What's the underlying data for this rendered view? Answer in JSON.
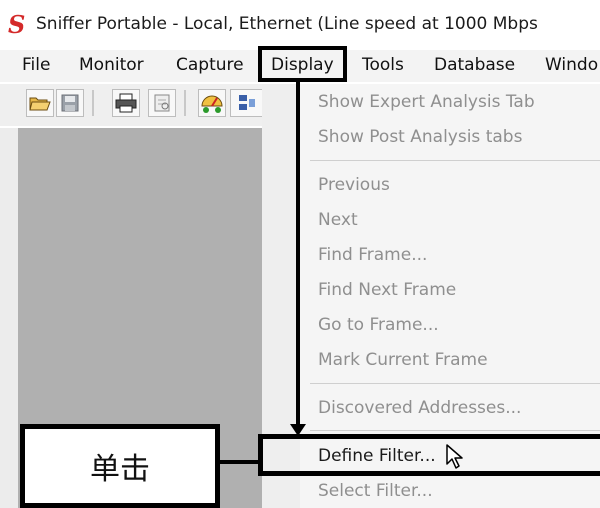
{
  "window": {
    "logo": "S",
    "title": "Sniffer Portable - Local, Ethernet (Line speed at 1000 Mbps"
  },
  "menubar": {
    "items": [
      {
        "label": "File"
      },
      {
        "label": "Monitor"
      },
      {
        "label": "Capture"
      },
      {
        "label": "Display"
      },
      {
        "label": "Tools"
      },
      {
        "label": "Database"
      },
      {
        "label": "Windo"
      }
    ],
    "active": "Display"
  },
  "toolbar": {
    "icons": [
      "open-folder-icon",
      "save-icon",
      "print-icon",
      "print-preview-icon",
      "dashboard-icon",
      "host-table-icon"
    ]
  },
  "display_menu": {
    "items": [
      {
        "label": "Show Expert Analysis Tab",
        "enabled": false
      },
      {
        "label": "Show Post Analysis tabs",
        "enabled": false
      },
      {
        "label": "Previous",
        "enabled": false
      },
      {
        "label": "Next",
        "enabled": false
      },
      {
        "label": "Find Frame...",
        "enabled": false
      },
      {
        "label": "Find Next Frame",
        "enabled": false
      },
      {
        "label": "Go to Frame...",
        "enabled": false
      },
      {
        "label": "Mark Current Frame",
        "enabled": false
      },
      {
        "label": "Discovered Addresses...",
        "enabled": false
      },
      {
        "label": "Define Filter...",
        "enabled": true
      },
      {
        "label": "Select Filter...",
        "enabled": false
      }
    ]
  },
  "annotation": {
    "callout": "单击",
    "color": "#000000"
  },
  "colors": {
    "logo": "#d42a2a",
    "workarea": "#b0b0b0",
    "disabled_text": "#8f8f8f"
  }
}
